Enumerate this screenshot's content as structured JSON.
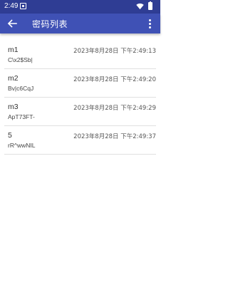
{
  "status_bar": {
    "time": "2:49",
    "notification_icon": "notification-box-icon",
    "wifi_icon": "wifi-icon",
    "battery_icon": "battery-icon"
  },
  "app_bar": {
    "title": "密码列表",
    "back_icon": "arrow-back-icon",
    "menu_icon": "overflow-menu-icon",
    "color": "#3f51b5"
  },
  "passwords": [
    {
      "name": "m1",
      "password": "C\\x2$Sb|",
      "date": "2023年8月28日 下午2:49:13"
    },
    {
      "name": "m2",
      "password": "Bv|c6CqJ",
      "date": "2023年8月28日 下午2:49:20"
    },
    {
      "name": "m3",
      "password": "ApT73FT-",
      "date": "2023年8月28日 下午2:49:29"
    },
    {
      "name": "5",
      "password": "rR^wwNIL",
      "date": "2023年8月28日 下午2:49:37"
    }
  ]
}
